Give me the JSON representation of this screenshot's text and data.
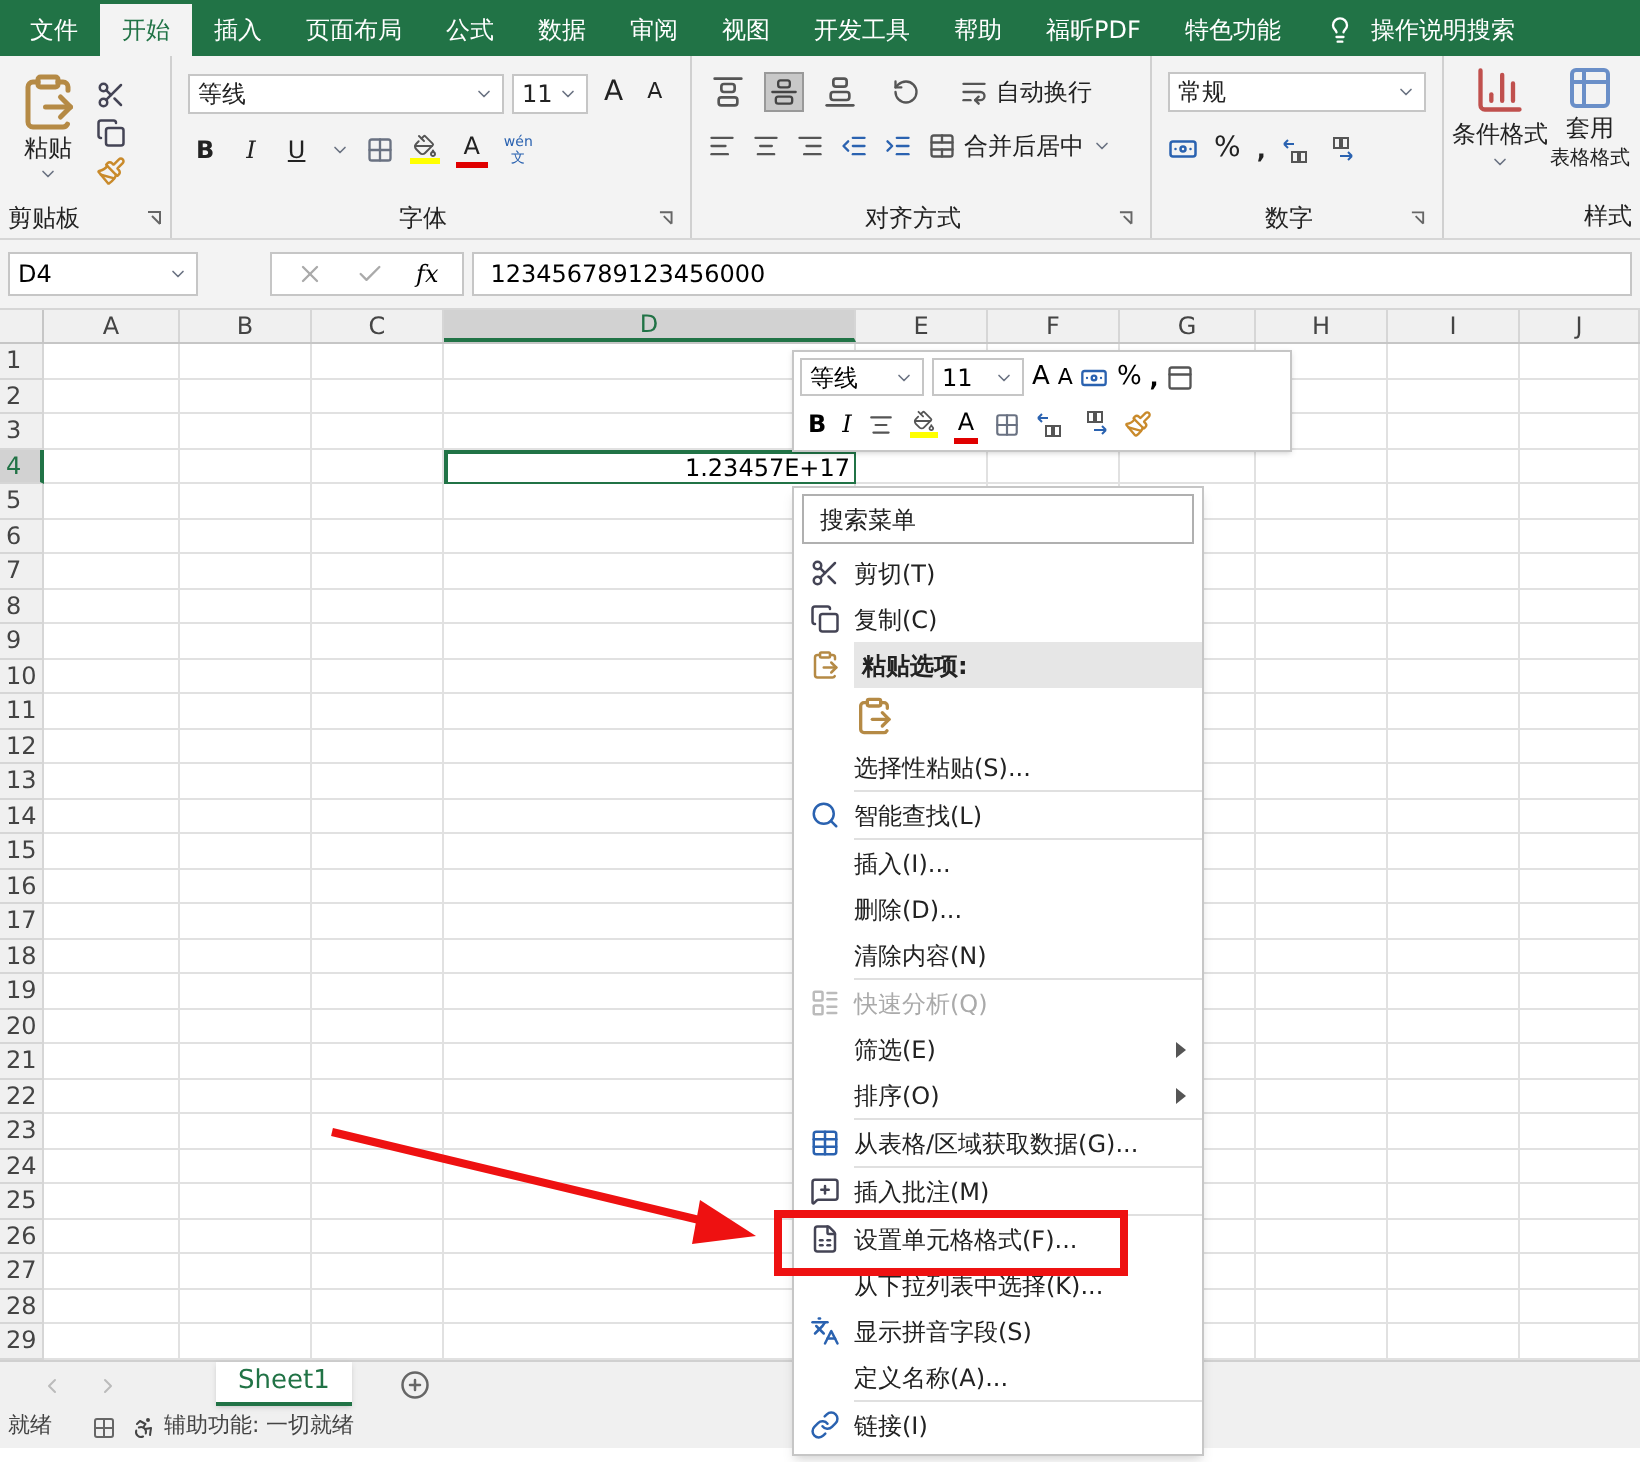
{
  "tabs": [
    {
      "label": "文件",
      "selected": false
    },
    {
      "label": "开始",
      "selected": true
    },
    {
      "label": "插入",
      "selected": false
    },
    {
      "label": "页面布局",
      "selected": false
    },
    {
      "label": "公式",
      "selected": false
    },
    {
      "label": "数据",
      "selected": false
    },
    {
      "label": "审阅",
      "selected": false
    },
    {
      "label": "视图",
      "selected": false
    },
    {
      "label": "开发工具",
      "selected": false
    },
    {
      "label": "帮助",
      "selected": false
    },
    {
      "label": "福昕PDF",
      "selected": false
    },
    {
      "label": "特色功能",
      "selected": false
    }
  ],
  "tell_me": "操作说明搜索",
  "clipboard": {
    "paste": "粘贴",
    "label": "剪贴板"
  },
  "font": {
    "name": "等线",
    "size": "11",
    "grow": "A",
    "shrink": "A",
    "bold": "B",
    "italic": "I",
    "underline": "U",
    "font_color": "A",
    "phonetic_top": "wén",
    "phonetic_bottom": "文",
    "label": "字体"
  },
  "alignment": {
    "vertical": [
      {
        "selected": false
      },
      {
        "selected": true
      },
      {
        "selected": false
      }
    ],
    "wrap": "自动换行",
    "merge": "合并后居中",
    "label": "对齐方式"
  },
  "number": {
    "format": "常规",
    "percent": "%",
    "comma": ",",
    "label": "数字"
  },
  "styles": {
    "conditional": "条件格式",
    "table_top": "套用",
    "table_bottom": "表格格式",
    "label": "样式"
  },
  "formula_bar": {
    "name_box": "D4",
    "fx": "fx",
    "content": "123456789123456000"
  },
  "columns": [
    {
      "label": "A",
      "selected": false
    },
    {
      "label": "B",
      "selected": false
    },
    {
      "label": "C",
      "selected": false
    },
    {
      "label": "D",
      "selected": true
    },
    {
      "label": "E",
      "selected": false
    },
    {
      "label": "F",
      "selected": false
    },
    {
      "label": "G",
      "selected": false
    },
    {
      "label": "H",
      "selected": false
    },
    {
      "label": "I",
      "selected": false
    },
    {
      "label": "J",
      "selected": false
    }
  ],
  "rows": [
    {
      "label": "1",
      "selected": false
    },
    {
      "label": "2",
      "selected": false
    },
    {
      "label": "3",
      "selected": false
    },
    {
      "label": "4",
      "selected": true,
      "value": "1.23457E+17"
    },
    {
      "label": "5",
      "selected": false
    },
    {
      "label": "6",
      "selected": false
    },
    {
      "label": "7",
      "selected": false
    },
    {
      "label": "8",
      "selected": false
    },
    {
      "label": "9",
      "selected": false
    },
    {
      "label": "10",
      "selected": false
    },
    {
      "label": "11",
      "selected": false
    },
    {
      "label": "12",
      "selected": false
    },
    {
      "label": "13",
      "selected": false
    },
    {
      "label": "14",
      "selected": false
    },
    {
      "label": "15",
      "selected": false
    },
    {
      "label": "16",
      "selected": false
    },
    {
      "label": "17",
      "selected": false
    },
    {
      "label": "18",
      "selected": false
    },
    {
      "label": "19",
      "selected": false
    },
    {
      "label": "20",
      "selected": false
    },
    {
      "label": "21",
      "selected": false
    },
    {
      "label": "22",
      "selected": false
    },
    {
      "label": "23",
      "selected": false
    },
    {
      "label": "24",
      "selected": false
    },
    {
      "label": "25",
      "selected": false
    },
    {
      "label": "26",
      "selected": false
    },
    {
      "label": "27",
      "selected": false
    },
    {
      "label": "28",
      "selected": false
    },
    {
      "label": "29",
      "selected": false
    }
  ],
  "mini_toolbar": {
    "font": "等线",
    "size": "11",
    "grow": "A",
    "shrink": "A",
    "percent": "%",
    "comma": ",",
    "bold": "B",
    "italic": "I",
    "font_color": "A"
  },
  "context_menu": {
    "search_placeholder": "搜索菜单",
    "items": [
      {
        "kind": "item",
        "label": "剪切(T)",
        "has_icon": true,
        "disabled": false,
        "submenu": false
      },
      {
        "kind": "item",
        "label": "复制(C)",
        "has_icon": true,
        "disabled": false,
        "submenu": false
      },
      {
        "kind": "header",
        "label": "粘贴选项:",
        "has_icon": true
      },
      {
        "kind": "paste_option"
      },
      {
        "kind": "item",
        "label": "选择性粘贴(S)...",
        "has_icon": false,
        "disabled": false,
        "submenu": false
      },
      {
        "kind": "separator"
      },
      {
        "kind": "item",
        "label": "智能查找(L)",
        "has_icon": true,
        "disabled": false,
        "submenu": false
      },
      {
        "kind": "separator"
      },
      {
        "kind": "item",
        "label": "插入(I)...",
        "has_icon": false,
        "disabled": false,
        "submenu": false
      },
      {
        "kind": "item",
        "label": "删除(D)...",
        "has_icon": false,
        "disabled": false,
        "submenu": false
      },
      {
        "kind": "item",
        "label": "清除内容(N)",
        "has_icon": false,
        "disabled": false,
        "submenu": false
      },
      {
        "kind": "separator"
      },
      {
        "kind": "item",
        "label": "快速分析(Q)",
        "has_icon": true,
        "disabled": true,
        "submenu": false
      },
      {
        "kind": "item",
        "label": "筛选(E)",
        "has_icon": false,
        "disabled": false,
        "submenu": true
      },
      {
        "kind": "item",
        "label": "排序(O)",
        "has_icon": false,
        "disabled": false,
        "submenu": true
      },
      {
        "kind": "separator"
      },
      {
        "kind": "item",
        "label": "从表格/区域获取数据(G)...",
        "has_icon": true,
        "disabled": false,
        "submenu": false
      },
      {
        "kind": "separator"
      },
      {
        "kind": "item",
        "label": "插入批注(M)",
        "has_icon": true,
        "disabled": false,
        "submenu": false
      },
      {
        "kind": "separator"
      },
      {
        "kind": "item",
        "label": "设置单元格格式(F)...",
        "has_icon": true,
        "disabled": false,
        "submenu": false
      },
      {
        "kind": "item",
        "label": "从下拉列表中选择(K)...",
        "has_icon": false,
        "disabled": false,
        "submenu": false
      },
      {
        "kind": "item",
        "label": "显示拼音字段(S)",
        "has_icon": true,
        "disabled": false,
        "submenu": false
      },
      {
        "kind": "item",
        "label": "定义名称(A)...",
        "has_icon": false,
        "disabled": false,
        "submenu": false
      },
      {
        "kind": "separator"
      },
      {
        "kind": "item",
        "label": "链接(I)",
        "has_icon": true,
        "disabled": false,
        "submenu": false
      }
    ]
  },
  "sheets": [
    {
      "label": "Sheet1",
      "selected": true
    }
  ],
  "status_bar": {
    "ready": "就绪",
    "accessibility": "辅助功能: 一切就绪"
  }
}
